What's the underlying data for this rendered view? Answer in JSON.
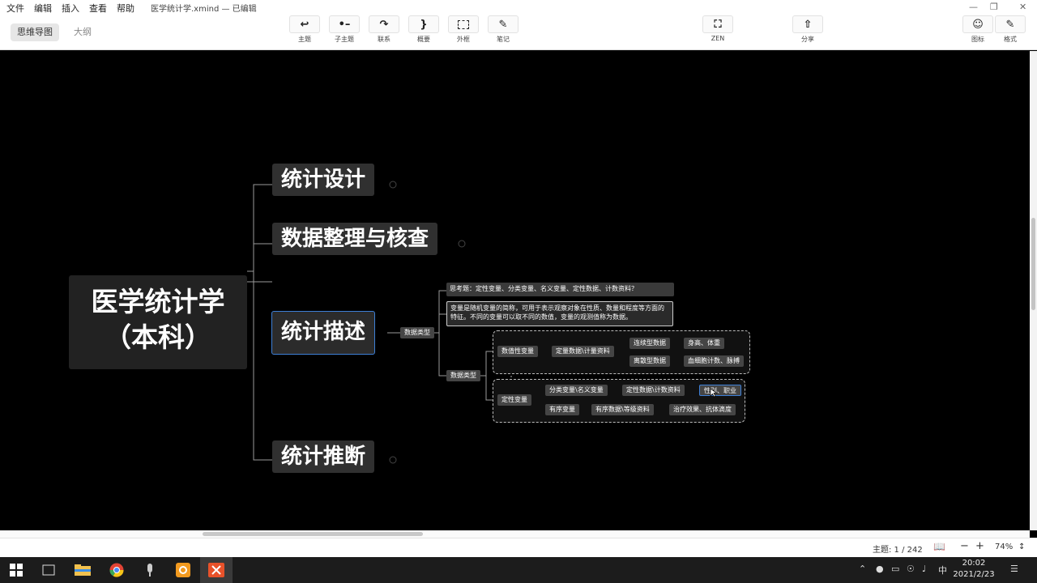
{
  "menu": {
    "file": "文件",
    "edit": "编辑",
    "insert": "插入",
    "view": "查看",
    "help": "帮助"
  },
  "window": {
    "title": "医学统计学.xmind — 已编辑"
  },
  "view_tabs": {
    "mindmap": "思维导图",
    "outline": "大纲"
  },
  "toolbar": {
    "topic": "主题",
    "subtopic": "子主题",
    "relationship": "联系",
    "summary": "概要",
    "boundary": "外框",
    "note": "笔记",
    "zen": "ZEN",
    "share": "分享",
    "icon": "图标",
    "format": "格式"
  },
  "mindmap": {
    "central": {
      "line1": "医学统计学",
      "line2": "（本科）"
    },
    "topics": {
      "design": "统计设计",
      "data": "数据整理与核查",
      "describe": "统计描述",
      "inference": "统计推断"
    },
    "describe_children": {
      "types_a": "数据类型",
      "question": "思考题：定性变量、分类变量、名义变量、定性数据、计数资料？",
      "definition": "变量是随机变量的简称，可用于表示观察对象在性质、数量和程度等方面的特征。不同的变量可以取不同的数值，变量的观测值称为数据。",
      "types_b": "数据类型",
      "numeric": "数值性变量",
      "quant_data": "定量数据\\计量资料",
      "continuous": "连续型数据",
      "height_weight": "身高、体重",
      "discrete": "离散型数据",
      "blood_count": "血细胞计数、脉搏",
      "qualitative": "定性变量",
      "categorical": "分类变量\\名义变量",
      "qual_data": "定性数据\\计数资料",
      "gender_blood": "性别、职业",
      "ordinal": "有序变量",
      "ordinal_data": "有序数据\\等级资料",
      "effect": "治疗效果、抗体滴度"
    }
  },
  "status": {
    "topic_count": "主题: 1 / 242",
    "zoom": "74%"
  },
  "clock": {
    "time": "20:02",
    "date": "2021/2/23"
  },
  "tray": {
    "ime": "中"
  }
}
